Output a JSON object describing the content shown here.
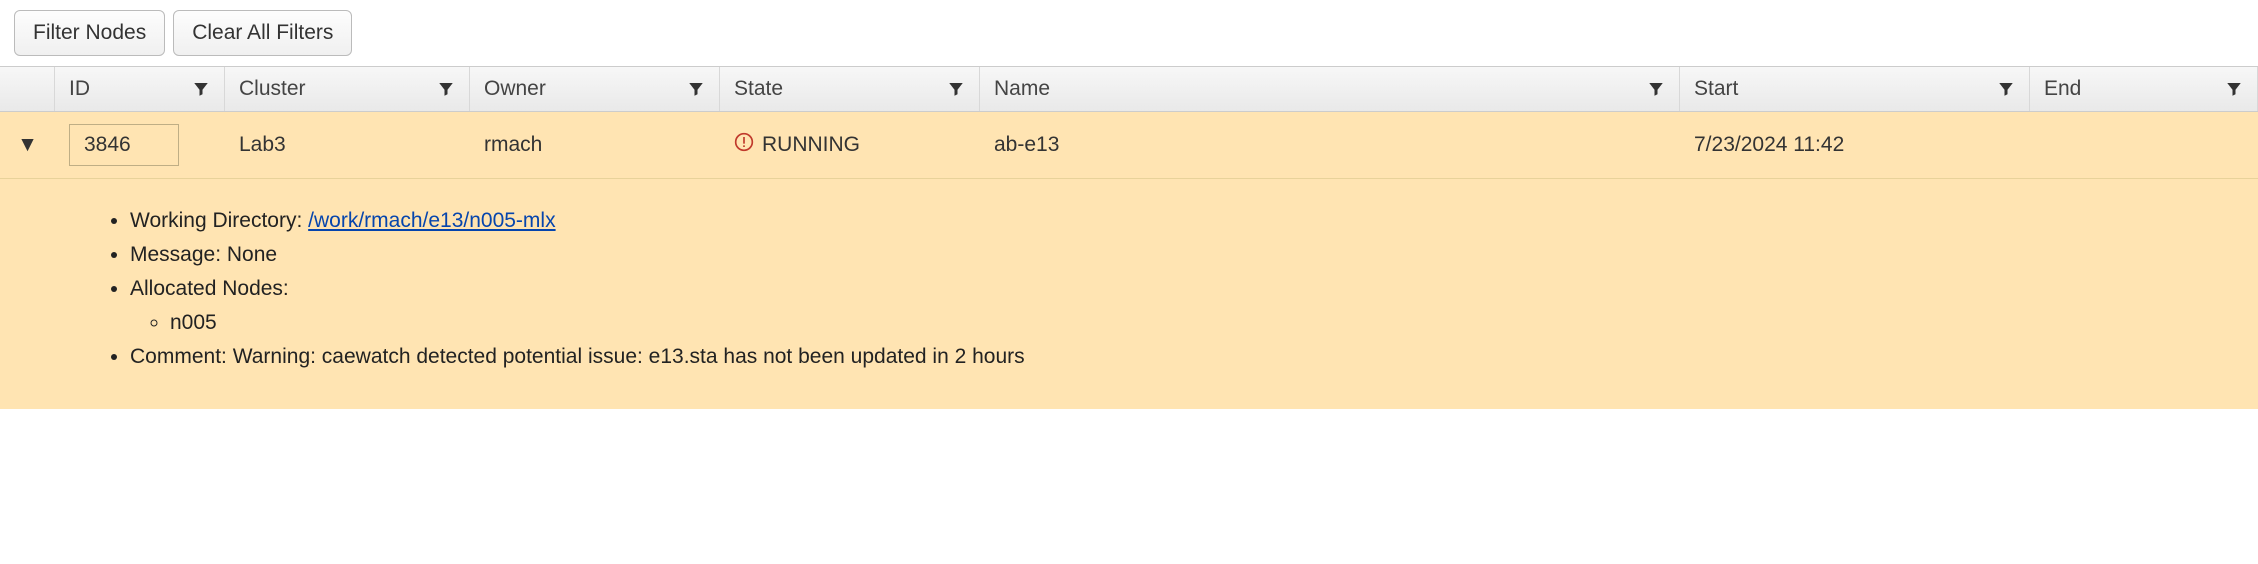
{
  "toolbar": {
    "filter_nodes_label": "Filter Nodes",
    "clear_filters_label": "Clear All Filters"
  },
  "columns": {
    "id": "ID",
    "cluster": "Cluster",
    "owner": "Owner",
    "state": "State",
    "name": "Name",
    "start": "Start",
    "end": "End"
  },
  "row": {
    "id": "3846",
    "cluster": "Lab3",
    "owner": "rmach",
    "state": "RUNNING",
    "name": "ab-e13",
    "start": "7/23/2024 11:42",
    "end": ""
  },
  "details": {
    "working_directory_label": "Working Directory: ",
    "working_directory_link": "/work/rmach/e13/n005-mlx",
    "message_label": "Message: ",
    "message_value": "None",
    "allocated_nodes_label": "Allocated Nodes:",
    "allocated_nodes": [
      "n005"
    ],
    "comment_label": "Comment: ",
    "comment_value": "Warning: caewatch detected potential issue: e13.sta has not been updated in 2 hours"
  }
}
